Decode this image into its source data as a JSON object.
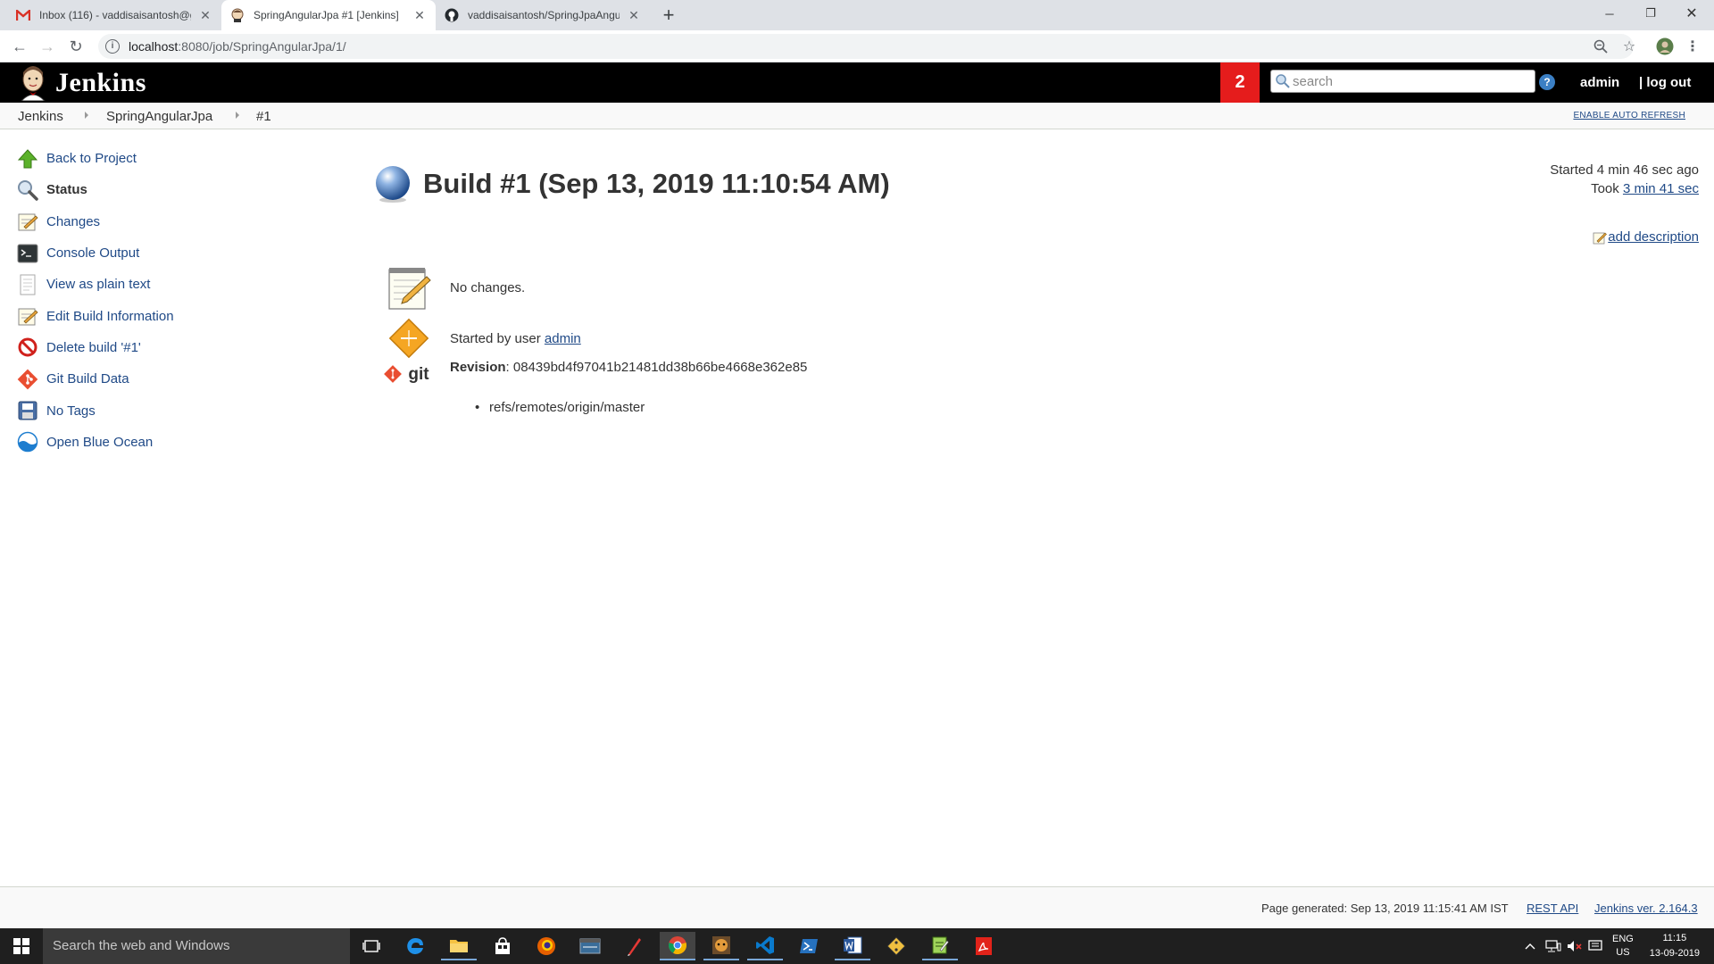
{
  "browser": {
    "tabs": [
      {
        "title": "Inbox (116) - vaddisaisantosh@g",
        "icon": "gmail-icon",
        "active": false
      },
      {
        "title": "SpringAngularJpa #1 [Jenkins]",
        "icon": "jenkins-favicon",
        "active": true
      },
      {
        "title": "vaddisaisantosh/SpringJpaAngul",
        "icon": "github-icon",
        "active": false
      }
    ],
    "url_host": "localhost",
    "url_path": ":8080/job/SpringAngularJpa/1/"
  },
  "header": {
    "brand": "Jenkins",
    "notification_count": "2",
    "search_placeholder": "search",
    "help": "?",
    "user": "admin",
    "logout": "| log out"
  },
  "breadcrumb": {
    "items": [
      "Jenkins",
      "SpringAngularJpa",
      "#1"
    ],
    "auto_refresh": "ENABLE AUTO REFRESH"
  },
  "sidebar": {
    "items": [
      {
        "label": "Back to Project",
        "icon": "up-arrow-icon"
      },
      {
        "label": "Status",
        "icon": "magnifier-icon"
      },
      {
        "label": "Changes",
        "icon": "notepad-icon"
      },
      {
        "label": "Console Output",
        "icon": "terminal-icon"
      },
      {
        "label": "View as plain text",
        "icon": "document-icon"
      },
      {
        "label": "Edit Build Information",
        "icon": "notepad-icon"
      },
      {
        "label": "Delete build '#1'",
        "icon": "no-entry-icon"
      },
      {
        "label": "Git Build Data",
        "icon": "git-icon"
      },
      {
        "label": "No Tags",
        "icon": "save-icon"
      },
      {
        "label": "Open Blue Ocean",
        "icon": "blue-ocean-icon"
      }
    ]
  },
  "build": {
    "title": "Build #1 (Sep 13, 2019 11:10:54 AM)",
    "status_color": "#3465a4",
    "started": "Started 4 min 46 sec ago",
    "took_prefix": "Took ",
    "took": "3 min 41 sec",
    "add_description": "add description",
    "changes": "No changes.",
    "started_by_prefix": "Started by user ",
    "started_by_user": "admin",
    "revision_label": "Revision",
    "revision_value": ": 08439bd4f97041b21481dd38b66be4668e362e85",
    "git_logo": "git",
    "branch": "refs/remotes/origin/master"
  },
  "footer": {
    "generated": "Page generated: Sep 13, 2019 11:15:41 AM IST",
    "rest_api": "REST API",
    "version": "Jenkins ver. 2.164.3"
  },
  "taskbar": {
    "search_placeholder": "Search the web and Windows",
    "lang_top": "ENG",
    "lang_bottom": "US",
    "time": "11:15",
    "date": "13-09-2019"
  }
}
